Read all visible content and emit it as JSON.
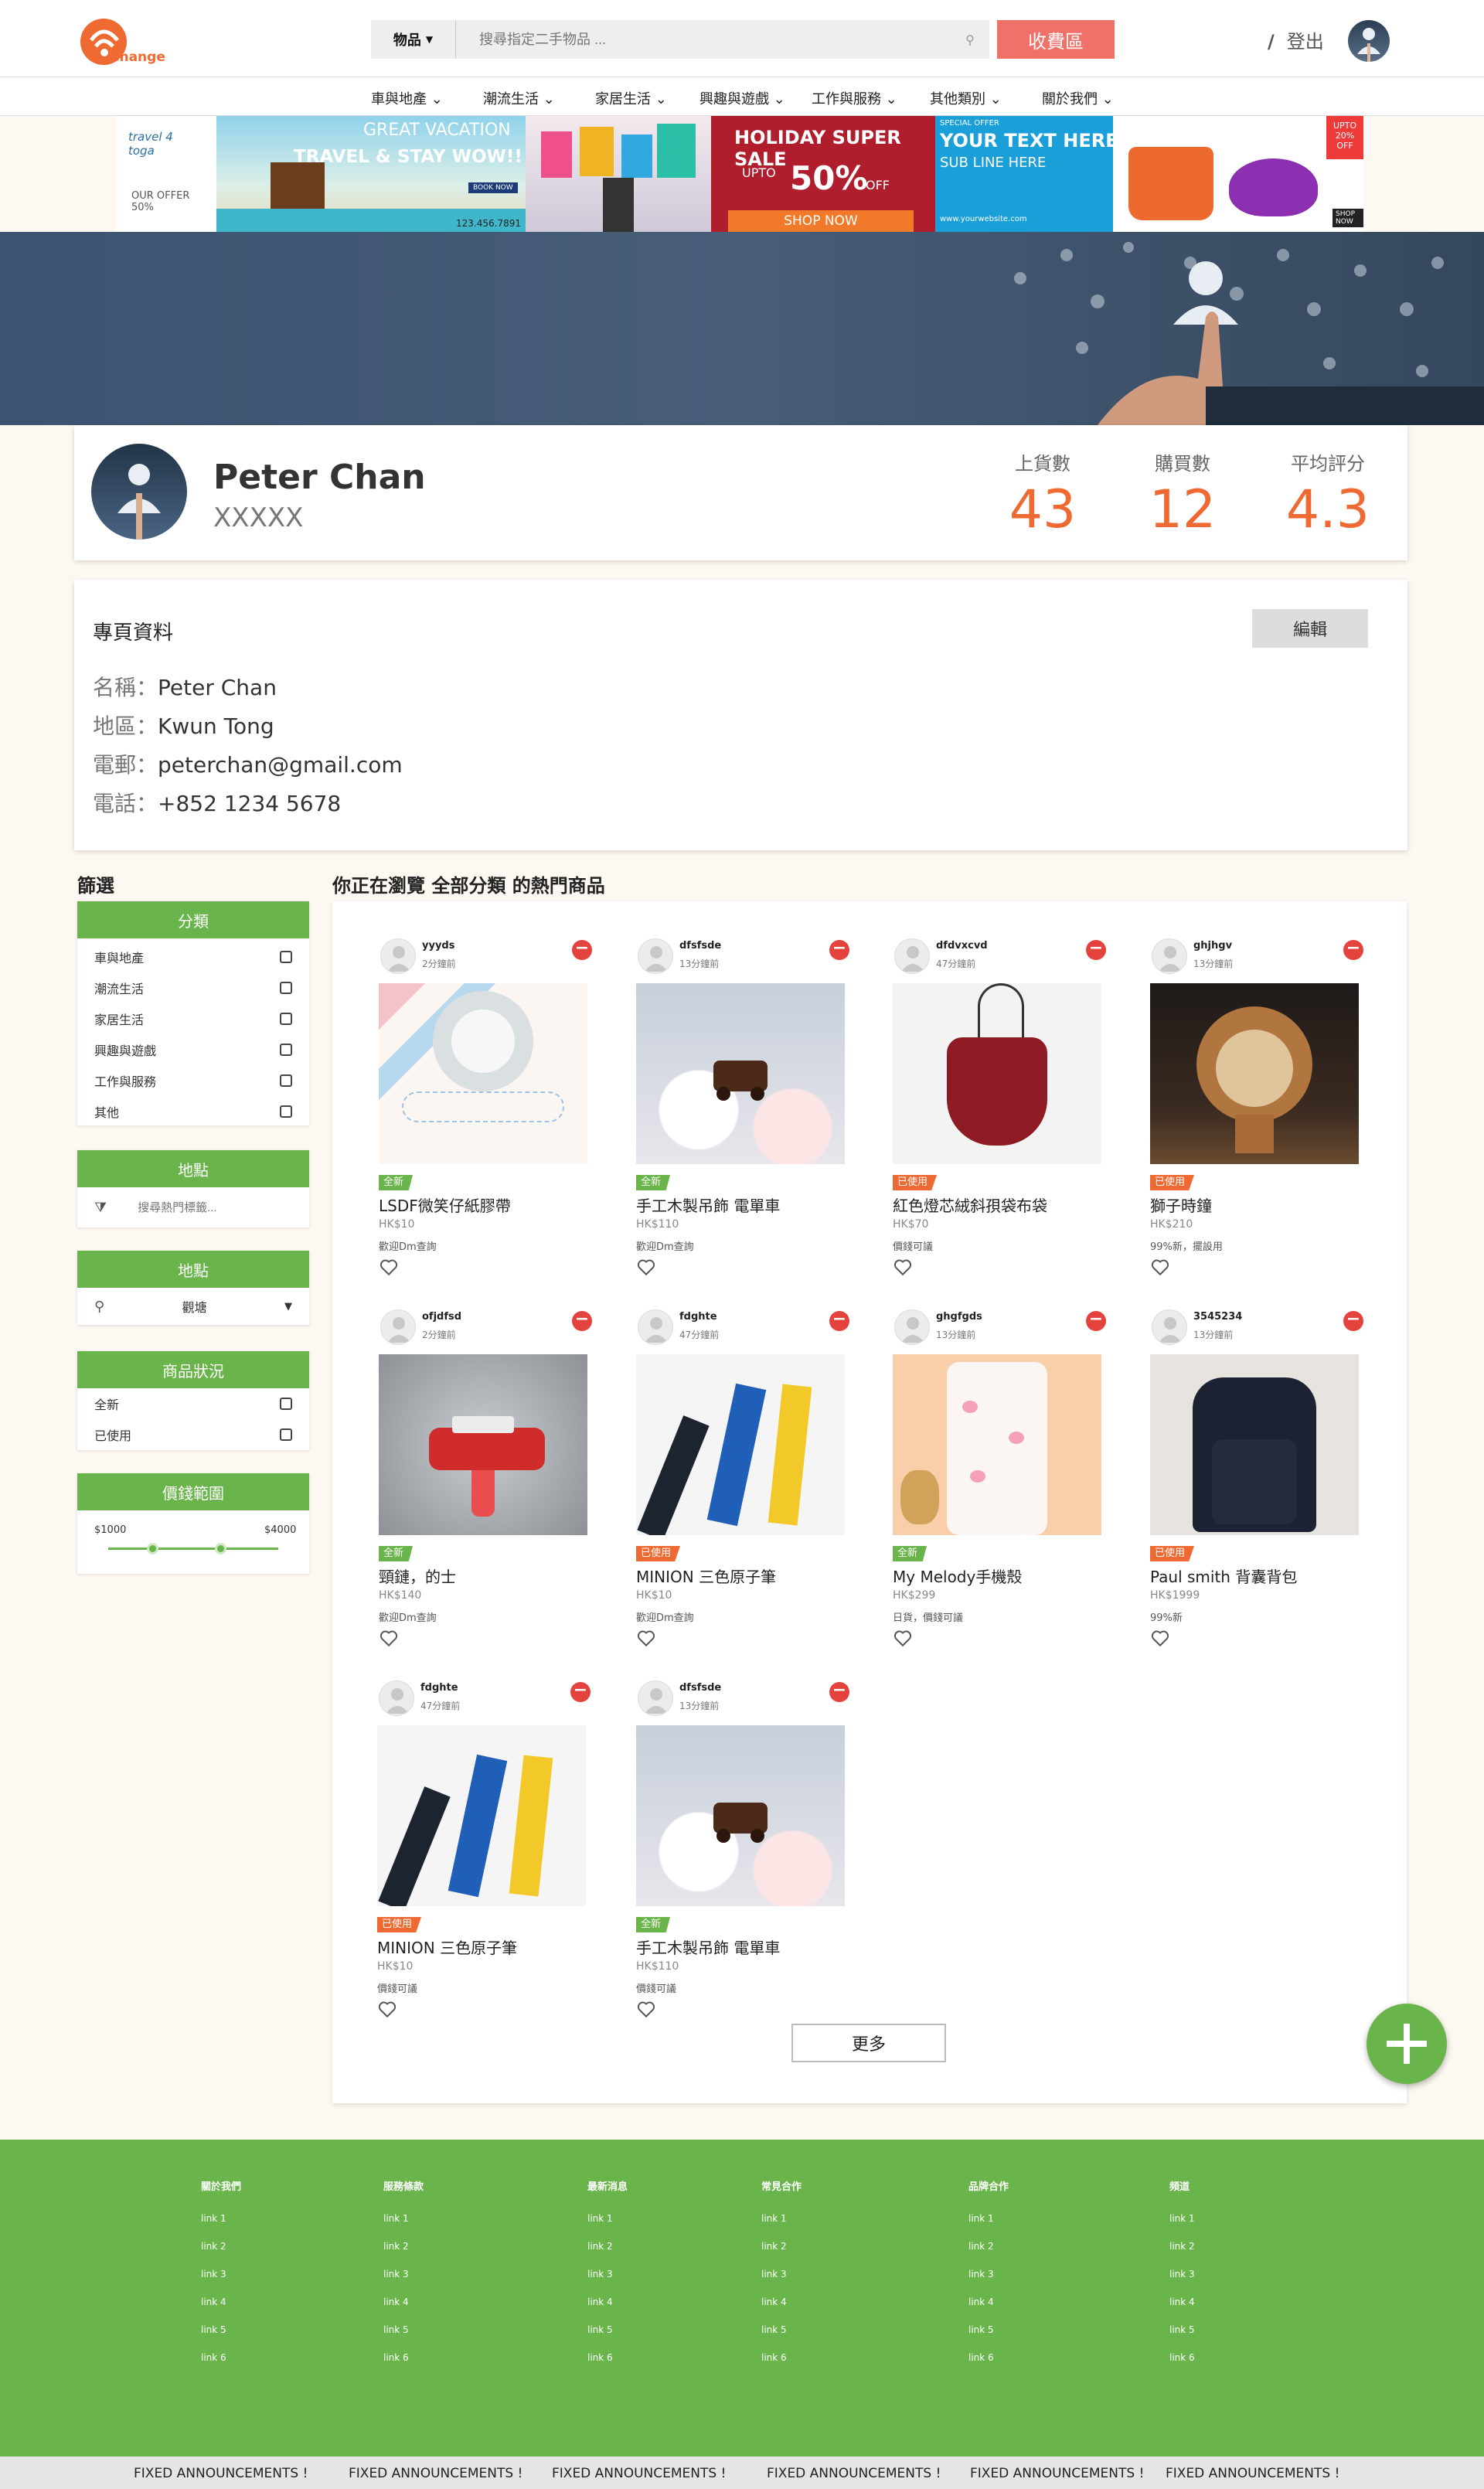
{
  "header": {
    "logo_text": "Change",
    "search_category": "物品",
    "search_placeholder": "搜尋指定二手物品 ...",
    "paid_area": "收費區",
    "logout": "登出"
  },
  "nav": [
    {
      "label": "車與地產"
    },
    {
      "label": "潮流生活"
    },
    {
      "label": "家居生活"
    },
    {
      "label": "興趣與遊戲"
    },
    {
      "label": "工作與服務"
    },
    {
      "label": "其他類別"
    },
    {
      "label": "關於我們"
    }
  ],
  "ads": {
    "travel_line1": "GREAT VACATION",
    "travel_line2": "TRAVEL & STAY WOW!!",
    "travel_logo": "travel 4 toga",
    "travel_offer": "OUR OFFER 50%",
    "travel_book": "BOOK NOW",
    "travel_phone": "123.456.7891",
    "holiday_title": "HOLIDAY SUPER SALE",
    "holiday_upto": "UPTO",
    "holiday_pct": "50%",
    "holiday_off": "OFF",
    "holiday_shop": "SHOP NOW",
    "bag_special": "SPECIAL OFFER",
    "bag_headline": "YOUR TEXT HERE",
    "bag_subline": "SUB LINE HERE",
    "bag_site": "www.yourwebsite.com",
    "bag_upto": "UPTO 20% OFF",
    "bag_shop": "SHOP NOW"
  },
  "profile": {
    "name": "Peter Chan",
    "subtitle": "XXXXX",
    "stats": [
      {
        "label": "上貨數",
        "value": "43"
      },
      {
        "label": "購買數",
        "value": "12"
      },
      {
        "label": "平均評分",
        "value": "4.3"
      }
    ]
  },
  "info": {
    "title": "專頁資料",
    "edit": "編輯",
    "rows": [
      {
        "key": "名稱：",
        "value": "Peter Chan"
      },
      {
        "key": "地區：",
        "value": "Kwun Tong"
      },
      {
        "key": "電郵：",
        "value": "peterchan@gmail.com"
      },
      {
        "key": "電話：",
        "value": "+852 1234 5678"
      }
    ]
  },
  "filter": {
    "title": "篩選",
    "category_head": "分類",
    "categories": [
      "車與地產",
      "潮流生活",
      "家居生活",
      "興趣與遊戲",
      "工作與服務",
      "其他"
    ],
    "tag_head": "地點",
    "tag_placeholder": "搜尋熱門標籤...",
    "location_head": "地點",
    "location_value": "觀塘",
    "condition_head": "商品狀況",
    "conditions": [
      "全新",
      "已使用"
    ],
    "price_head": "價錢範圍",
    "price_min": "$1000",
    "price_max": "$4000"
  },
  "browse": {
    "title": "你正在瀏覽 全部分類 的熱門商品",
    "more": "更多"
  },
  "products": [
    {
      "user": "yyyds",
      "time": "2分鐘前",
      "badge": "全新",
      "title": "LSDF微笑仔紙膠帶",
      "price": "HK$10",
      "note": "歡迎Dm查詢"
    },
    {
      "user": "dfsfsde",
      "time": "13分鐘前",
      "badge": "全新",
      "title": "手工木製吊飾 電單車",
      "price": "HK$110",
      "note": "歡迎Dm查詢"
    },
    {
      "user": "dfdvxcvd",
      "time": "47分鐘前",
      "badge": "已使用",
      "title": "紅色燈芯絨斜孭袋布袋",
      "price": "HK$70",
      "note": "價錢可議"
    },
    {
      "user": "ghjhgv",
      "time": "13分鐘前",
      "badge": "已使用",
      "title": "獅子時鐘",
      "price": "HK$210",
      "note": "99%新，擺設用"
    },
    {
      "user": "ofjdfsd",
      "time": "2分鐘前",
      "badge": "全新",
      "title": "頸鏈，的士",
      "price": "HK$140",
      "note": "歡迎Dm查詢"
    },
    {
      "user": "fdghte",
      "time": "47分鐘前",
      "badge": "已使用",
      "title": "MINION 三色原子筆",
      "price": "HK$10",
      "note": "歡迎Dm查詢"
    },
    {
      "user": "ghgfgds",
      "time": "13分鐘前",
      "badge": "全新",
      "title": "My Melody手機殼",
      "price": "HK$299",
      "note": "日貨，價錢可議"
    },
    {
      "user": "3545234",
      "time": "13分鐘前",
      "badge": "已使用",
      "title": "Paul smith 背囊背包",
      "price": "HK$1999",
      "note": "99%新"
    },
    {
      "user": "fdghte",
      "time": "47分鐘前",
      "badge": "已使用",
      "title": "MINION 三色原子筆",
      "price": "HK$10",
      "note": "價錢可議"
    },
    {
      "user": "dfsfsde",
      "time": "13分鐘前",
      "badge": "全新",
      "title": "手工木製吊飾 電單車",
      "price": "HK$110",
      "note": "價錢可議"
    }
  ],
  "footer": {
    "columns": [
      {
        "head": "關於我們",
        "links": [
          "link 1",
          "link 2",
          "link 3",
          "link 4",
          "link 5",
          "link 6"
        ]
      },
      {
        "head": "服務條款",
        "links": [
          "link 1",
          "link 2",
          "link 3",
          "link 4",
          "link 5",
          "link 6"
        ]
      },
      {
        "head": "最新消息",
        "links": [
          "link 1",
          "link 2",
          "link 3",
          "link 4",
          "link 5",
          "link 6"
        ]
      },
      {
        "head": "常見合作",
        "links": [
          "link 1",
          "link 2",
          "link 3",
          "link 4",
          "link 5",
          "link 6"
        ]
      },
      {
        "head": "品牌合作",
        "links": [
          "link 1",
          "link 2",
          "link 3",
          "link 4",
          "link 5",
          "link 6"
        ]
      },
      {
        "head": "頻道",
        "links": [
          "link 1",
          "link 2",
          "link 3",
          "link 4",
          "link 5",
          "link 6"
        ]
      }
    ],
    "announcement": "FIXED ANNOUNCEMENTS !",
    "announcements": [
      "FIXED ANNOUNCEMENTS !",
      "FIXED ANNOUNCEMENTS !",
      "FIXED ANNOUNCEMENTS !",
      "FIXED ANNOUNCEMENTS !",
      "FIXED ANNOUNCEMENTS !",
      "FIXED ANNOUNCEMENTS !"
    ]
  },
  "colors": {
    "green": "#6ab54b",
    "orange": "#ef6a32",
    "red": "#e4433d",
    "paid": "#f0706a",
    "badge_used": "#ef6a32",
    "badge_new": "#6ab54b"
  },
  "icons": [
    "search-icon",
    "chevron-down-icon",
    "slash-icon",
    "tag-icon",
    "location-pin-icon",
    "remove-icon",
    "heart-icon",
    "plus-icon"
  ]
}
